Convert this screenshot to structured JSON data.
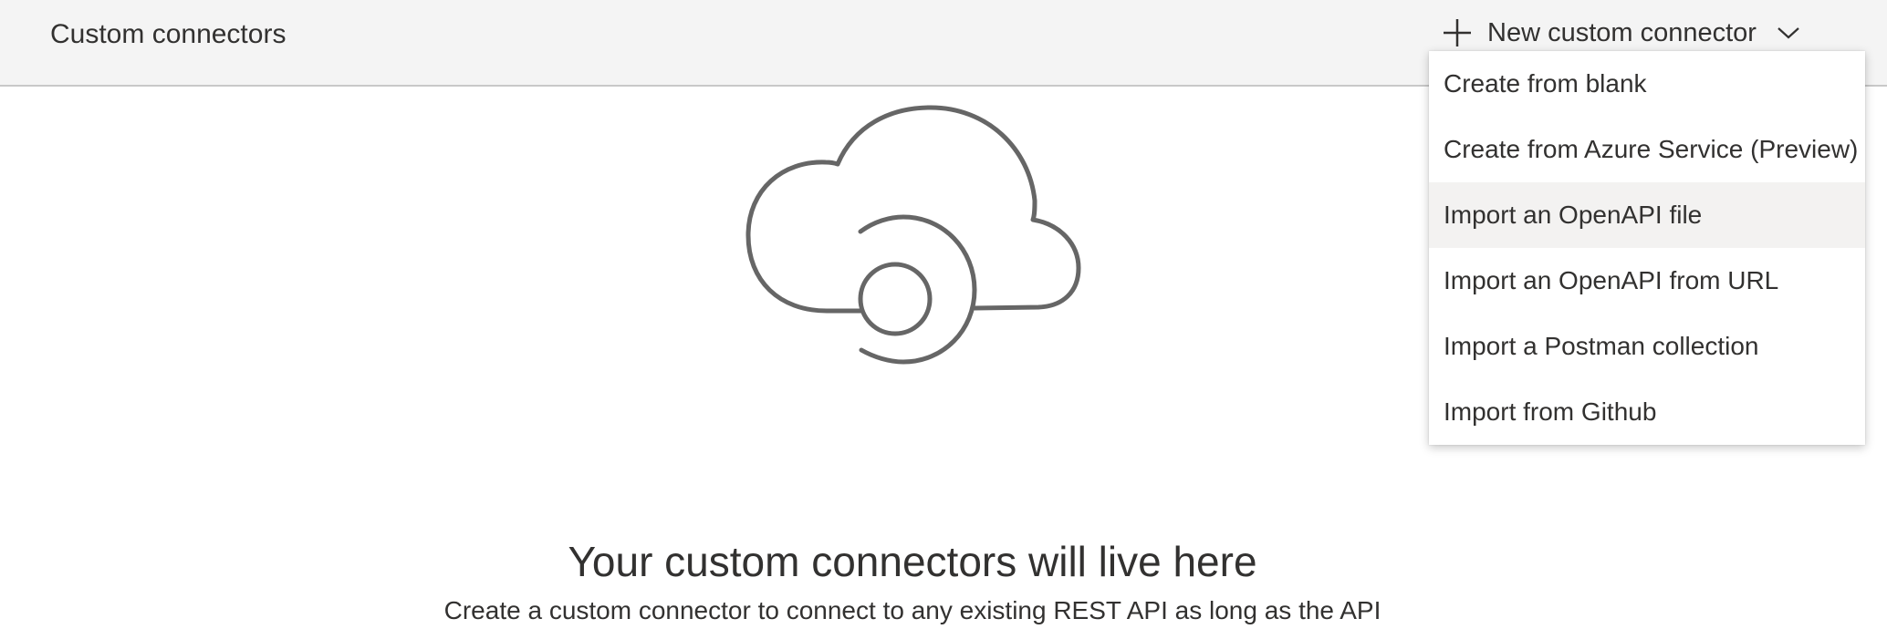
{
  "header": {
    "title": "Custom connectors",
    "new_button_label": "New custom connector",
    "new_button_icon": "plus-icon",
    "dropdown_icon": "chevron-down-icon"
  },
  "menu": {
    "items": [
      {
        "label": "Create from blank"
      },
      {
        "label": "Create from Azure Service (Preview)"
      },
      {
        "label": "Import an OpenAPI file"
      },
      {
        "label": "Import an OpenAPI from URL"
      },
      {
        "label": "Import a Postman collection"
      },
      {
        "label": "Import from Github"
      }
    ],
    "hovered_index": 2
  },
  "empty_state": {
    "illustration": "cloud-connector-icon",
    "title": "Your custom connectors will live here",
    "subtitle": "Create a custom connector to connect to any existing REST API as long as the API"
  },
  "colors": {
    "header_bg": "#f4f4f4",
    "text": "#323130",
    "icon_stroke": "#666666",
    "menu_hover": "#f3f2f1"
  }
}
